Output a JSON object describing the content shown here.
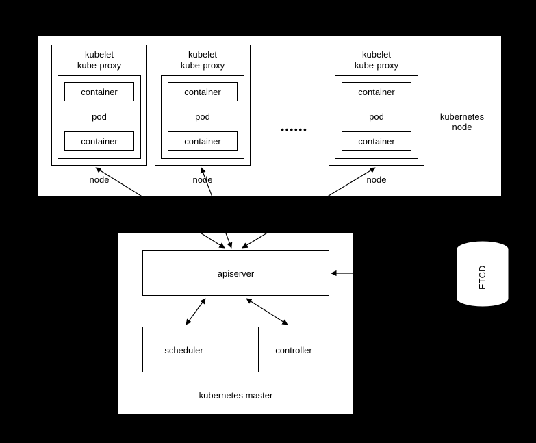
{
  "diagram": {
    "top_region_label": "kubernetes\nnode",
    "node_label": "node",
    "kubelet_label": "kubelet",
    "kubeproxy_label": "kube-proxy",
    "pod_label": "pod",
    "container_label": "container",
    "ellipsis": "••••••",
    "master": {
      "title": "kubernetes master",
      "apiserver": "apiserver",
      "scheduler": "scheduler",
      "controller": "controller"
    },
    "etcd": "ETCD"
  }
}
